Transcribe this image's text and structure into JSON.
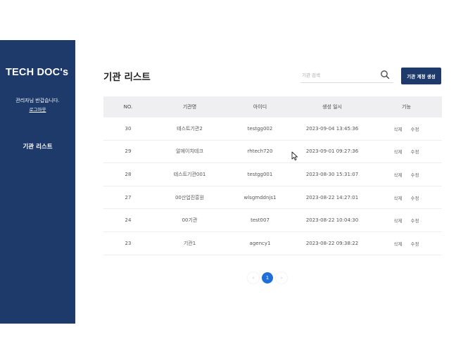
{
  "sidebar": {
    "logo": "TECH DOC's",
    "greeting": "관리자님 반갑습니다.",
    "logout_label": "로그아웃",
    "nav_items": [
      {
        "label": "기관 리스트"
      }
    ]
  },
  "main": {
    "title": "기관 리스트",
    "search": {
      "placeholder": "기관 검색"
    },
    "create_button_label": "기관 계정 생성"
  },
  "table": {
    "headers": [
      "NO.",
      "기관명",
      "아이디",
      "생성 일시",
      "기능"
    ],
    "delete_label": "삭제",
    "edit_label": "수정",
    "rows": [
      {
        "no": "30",
        "name": "테스트기관2",
        "id": "testgg002",
        "created": "2023-09-04 13:45:36"
      },
      {
        "no": "29",
        "name": "알에이치테크",
        "id": "rhtech720",
        "created": "2023-09-01 09:27:36"
      },
      {
        "no": "28",
        "name": "테스트기관001",
        "id": "testgg001",
        "created": "2023-08-30 15:31:07"
      },
      {
        "no": "27",
        "name": "00산업진흥원",
        "id": "wlsgmddnjs1",
        "created": "2023-08-22 14:27:01"
      },
      {
        "no": "24",
        "name": "00기관",
        "id": "test007",
        "created": "2023-08-22 10:04:30"
      },
      {
        "no": "23",
        "name": "기관1",
        "id": "agency1",
        "created": "2023-08-22 09:38:22"
      }
    ]
  },
  "pagination": {
    "prev": "‹",
    "current": "1",
    "next": "›"
  },
  "colors": {
    "sidebar_bg": "#1d3a6b",
    "accent": "#1e6fd9"
  }
}
